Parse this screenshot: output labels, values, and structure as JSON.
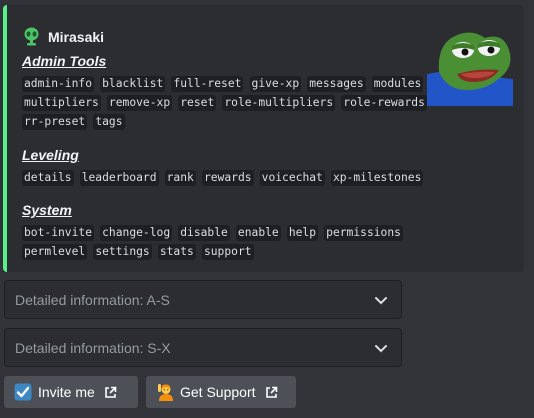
{
  "embed": {
    "accent_color": "#57f287",
    "author": {
      "name": "Mirasaki",
      "icon": "green-alien-avatar-icon"
    },
    "thumbnail": "pepe-frog-thumbnail",
    "sections": [
      {
        "title": "Admin Tools",
        "rows": [
          [
            "admin-info",
            "blacklist",
            "full-reset",
            "give-xp",
            "messages",
            "modules"
          ],
          [
            "multipliers",
            "remove-xp",
            "reset",
            "role-multipliers",
            "role-rewards"
          ],
          [
            "rr-preset",
            "tags"
          ]
        ]
      },
      {
        "title": "Leveling",
        "rows": [
          [
            "details",
            "leaderboard",
            "rank",
            "rewards",
            "voicechat",
            "xp-milestones"
          ]
        ]
      },
      {
        "title": "System",
        "rows": [
          [
            "bot-invite",
            "change-log",
            "disable",
            "enable",
            "help",
            "permissions"
          ],
          [
            "permlevel",
            "settings",
            "stats",
            "support"
          ]
        ]
      }
    ]
  },
  "selects": [
    {
      "placeholder": "Detailed information: A-S"
    },
    {
      "placeholder": "Detailed information: S-X"
    }
  ],
  "buttons": [
    {
      "label": "Invite me",
      "emoji": "check-box-icon"
    },
    {
      "label": "Get Support",
      "emoji": "person-raising-hand-icon"
    }
  ]
}
